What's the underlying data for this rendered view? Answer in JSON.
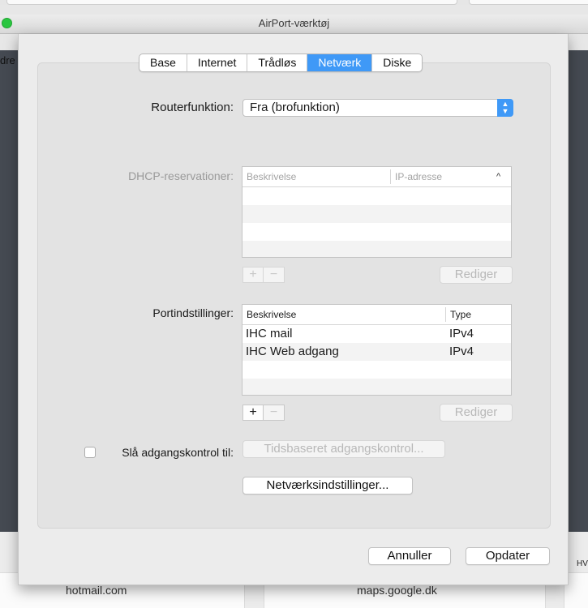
{
  "window": {
    "title": "AirPort-værktøj"
  },
  "background": {
    "left_edge_text": "dre",
    "right_edge_text": "HV",
    "tiles": [
      "hotmail.com",
      "maps.google.dk"
    ]
  },
  "tabs": [
    {
      "label": "Base",
      "active": false
    },
    {
      "label": "Internet",
      "active": false
    },
    {
      "label": "Trådløs",
      "active": false
    },
    {
      "label": "Netværk",
      "active": true
    },
    {
      "label": "Diske",
      "active": false
    }
  ],
  "router": {
    "label": "Routerfunktion:",
    "value": "Fra (brofunktion)"
  },
  "dhcp": {
    "label": "DHCP-reservationer:",
    "columns": [
      "Beskrivelse",
      "IP-adresse"
    ],
    "sort_indicator": "^",
    "edit_label": "Rediger",
    "add_symbol": "+",
    "remove_symbol": "−"
  },
  "ports": {
    "label": "Portindstillinger:",
    "columns": [
      "Beskrivelse",
      "Type"
    ],
    "rows": [
      {
        "description": "IHC mail",
        "type": "IPv4"
      },
      {
        "description": "IHC Web adgang",
        "type": "IPv4"
      }
    ],
    "edit_label": "Rediger",
    "add_symbol": "+",
    "remove_symbol": "−"
  },
  "access": {
    "checkbox_label": "Slå adgangskontrol til:",
    "checked": false,
    "timed_button": "Tidsbaseret adgangskontrol..."
  },
  "network_settings_button": "Netværksindstillinger...",
  "footer": {
    "cancel": "Annuller",
    "update": "Opdater"
  },
  "colors": {
    "accent": "#3f99f7",
    "traffic_light": "#2ac640"
  }
}
